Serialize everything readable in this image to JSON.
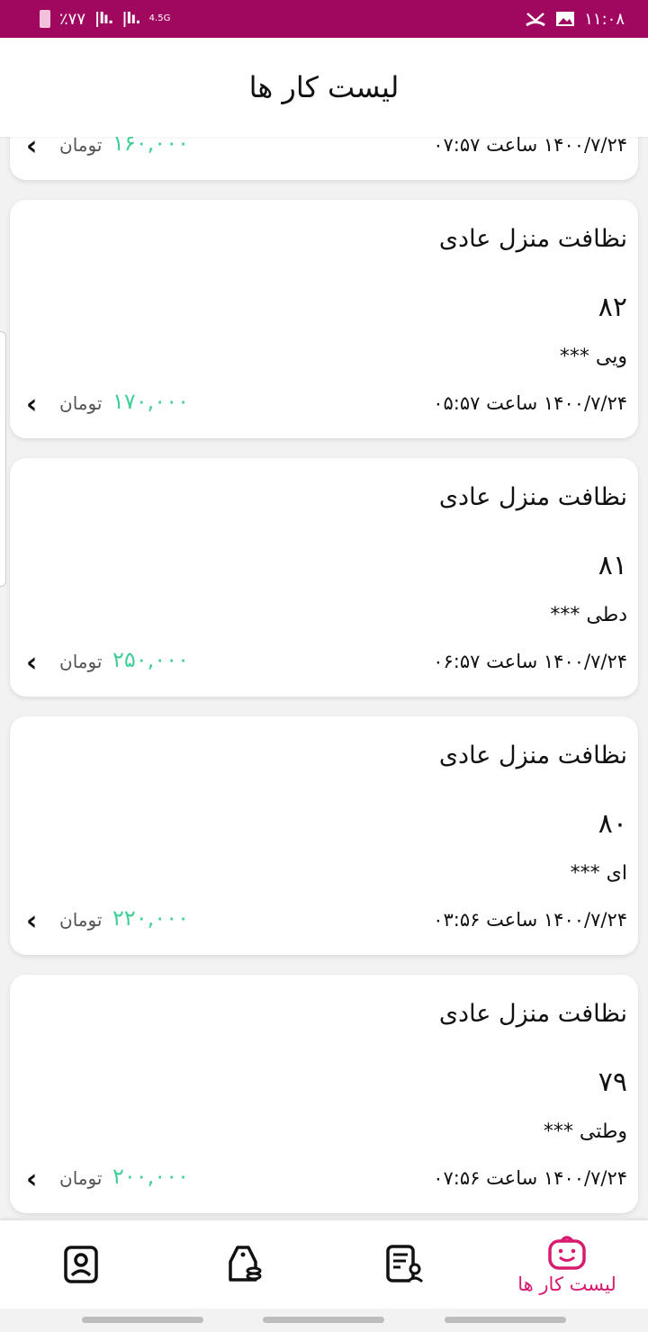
{
  "status_bar": {
    "time": "۱۱:۰۸",
    "battery": "٪۷۷",
    "signal1": "|lı.",
    "signal2": "|lı.",
    "network": "4.5G"
  },
  "header": {
    "title": "لیست کار ها"
  },
  "partial_card": {
    "date": "۱۴۰۰/۷/۲۴ ساعت ۰۷:۵۷",
    "price": "۱۶۰,۰۰۰",
    "currency": "تومان"
  },
  "jobs": [
    {
      "title": "نظافت منزل عادی",
      "id": "۸۲",
      "name": "ویی ***",
      "date": "۱۴۰۰/۷/۲۴ ساعت ۰۵:۵۷",
      "price": "۱۷۰,۰۰۰",
      "currency": "تومان"
    },
    {
      "title": "نظافت منزل عادی",
      "id": "۸۱",
      "name": "دطی ***",
      "date": "۱۴۰۰/۷/۲۴ ساعت ۰۶:۵۷",
      "price": "۲۵۰,۰۰۰",
      "currency": "تومان"
    },
    {
      "title": "نظافت منزل عادی",
      "id": "۸۰",
      "name": "ای ***",
      "date": "۱۴۰۰/۷/۲۴ ساعت ۰۳:۵۶",
      "price": "۲۲۰,۰۰۰",
      "currency": "تومان"
    },
    {
      "title": "نظافت منزل عادی",
      "id": "۷۹",
      "name": "وطتی ***",
      "date": "۱۴۰۰/۷/۲۴ ساعت ۰۷:۵۶",
      "price": "۲۰۰,۰۰۰",
      "currency": "تومان"
    }
  ],
  "bottom_nav": {
    "active_label": "لیست کار ها",
    "items": [
      "profile-icon",
      "wallet-icon",
      "job-users-icon",
      "job-list-icon"
    ]
  },
  "colors": {
    "status_bar": "#a0085f",
    "accent": "#d81b6f",
    "price": "#3fcf94"
  }
}
